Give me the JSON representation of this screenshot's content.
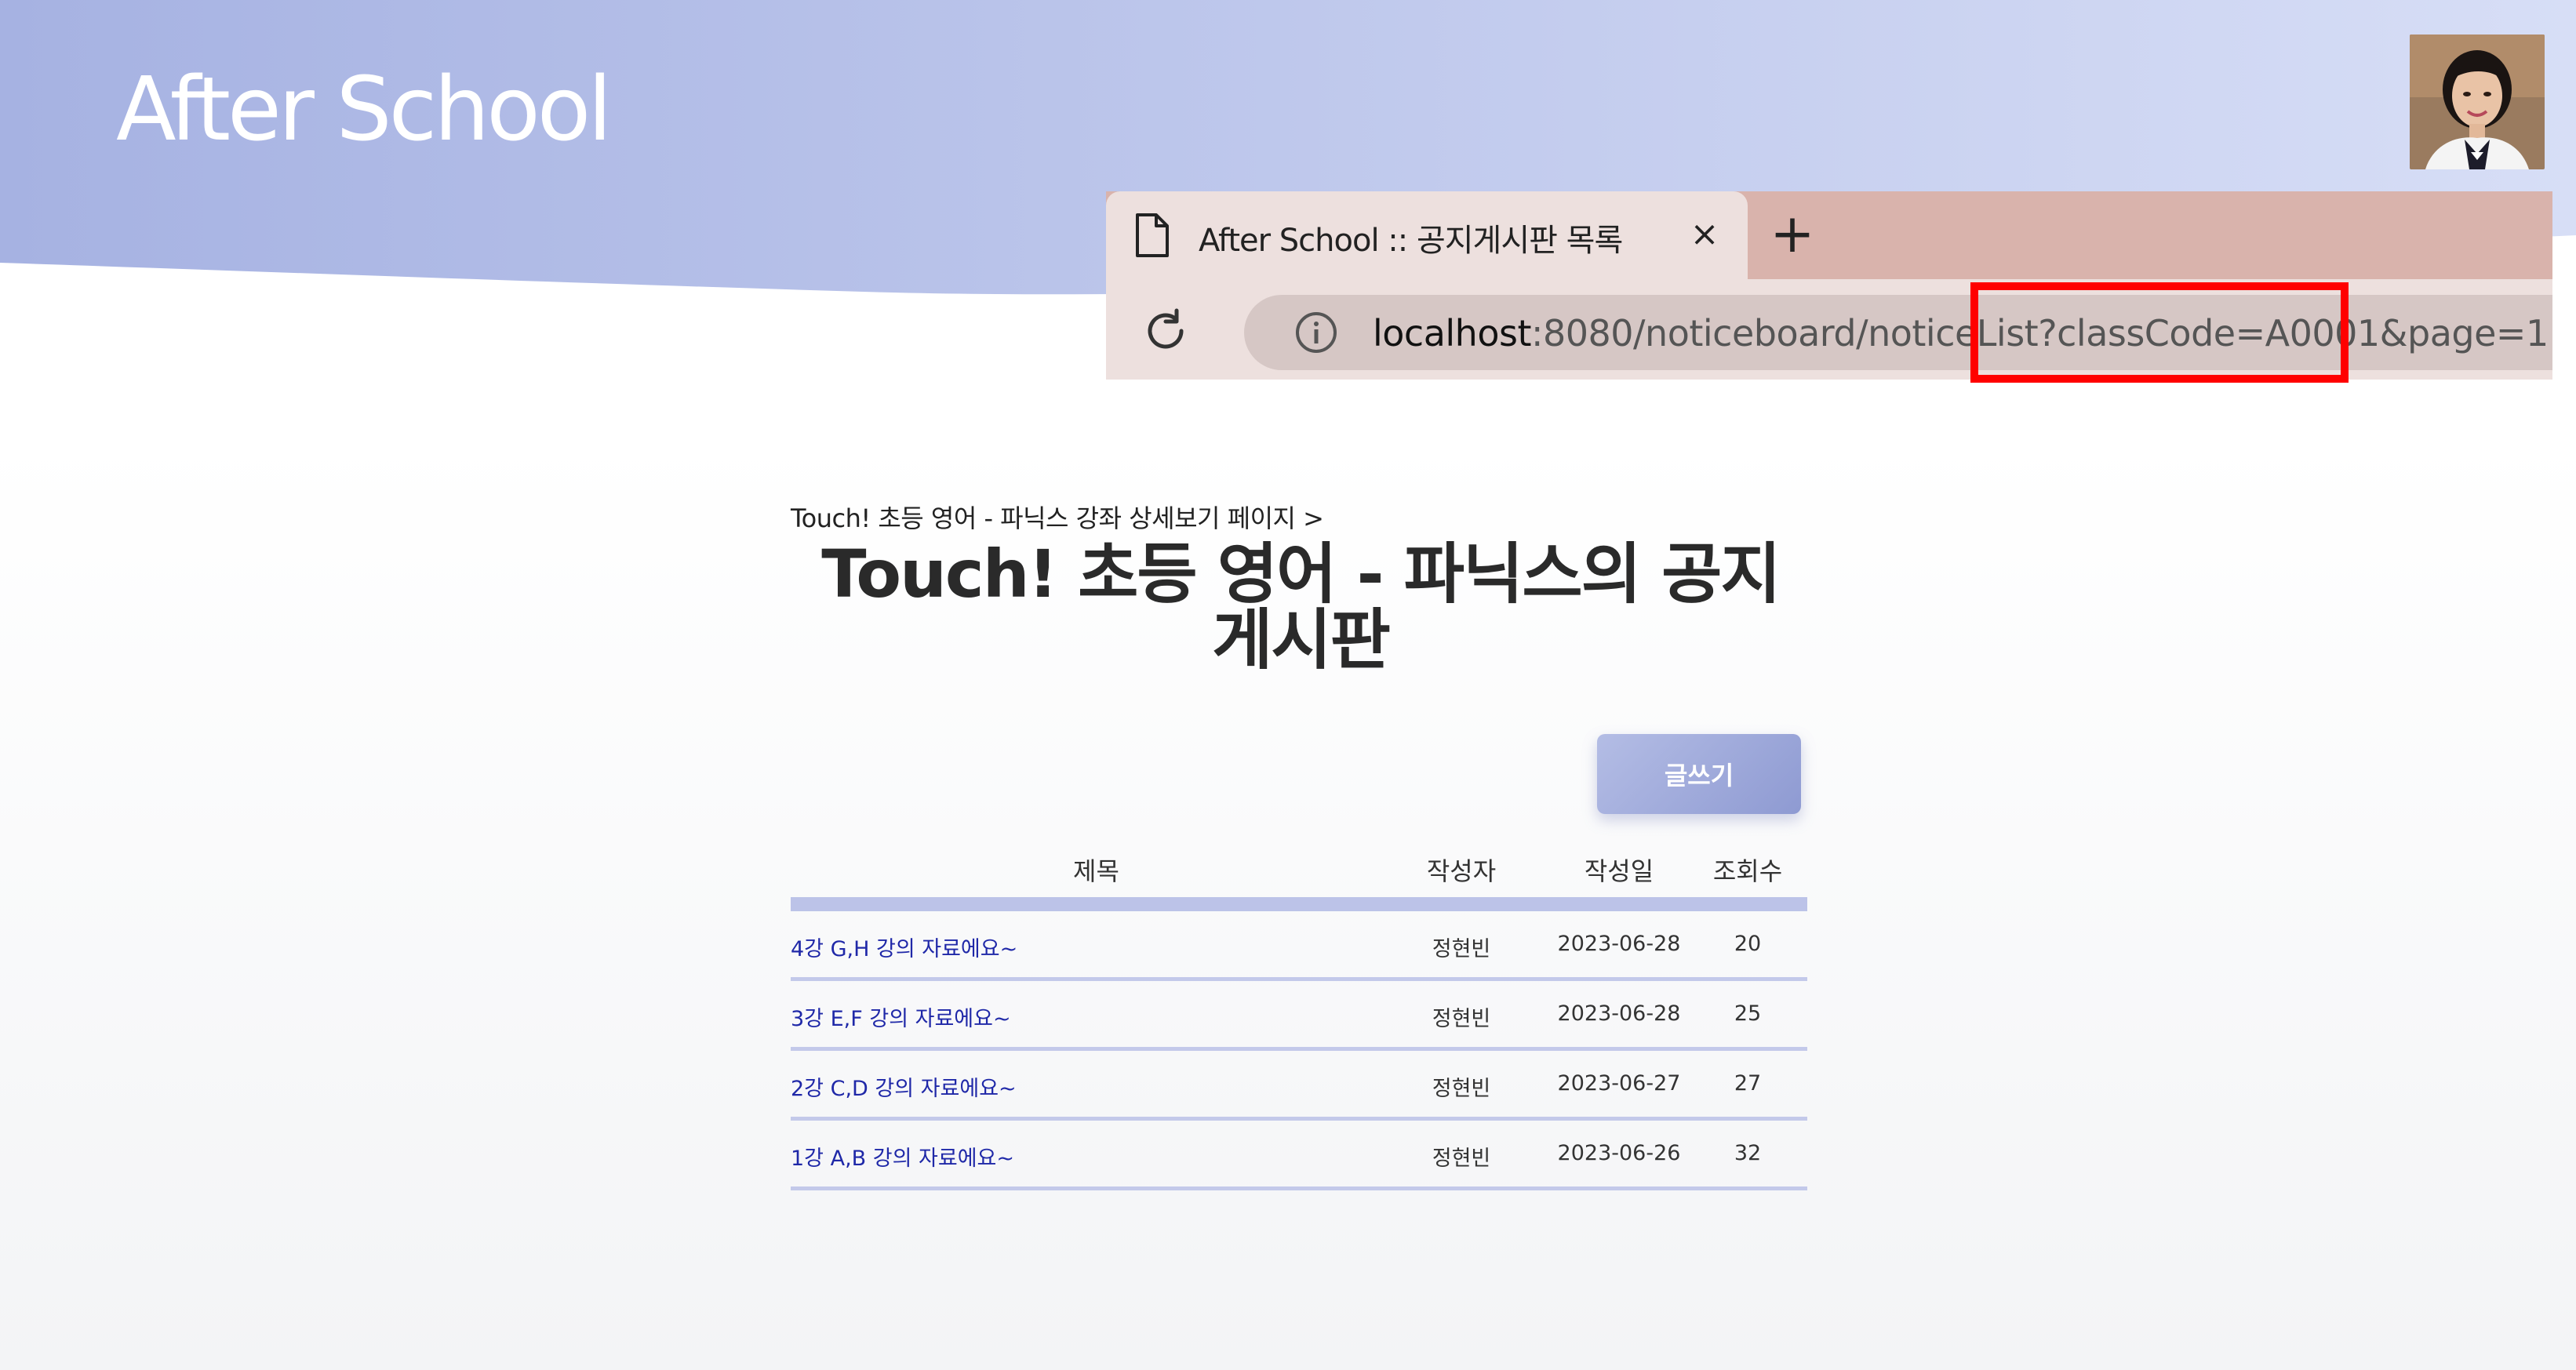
{
  "header": {
    "site_title": "After School",
    "colors": {
      "gradient_start": "#a6b2e2",
      "gradient_end": "#d7def6"
    }
  },
  "browser": {
    "tab_title": "After School :: 공지게시판 목록",
    "tab_close_label": "×",
    "new_tab_label": "+",
    "url_host": "localhost",
    "url_rest": ":8080/noticeboard/noticeList?classCode=A0001&page=1",
    "highlight_color": "#ff0000"
  },
  "content": {
    "breadcrumb": "Touch! 초등 영어 - 파닉스 강좌 상세보기 페이지 >",
    "title": "Touch! 초등 영어 - 파닉스의 공지 게시판",
    "write_button": "글쓰기",
    "columns": {
      "title": "제목",
      "writer": "작성자",
      "date": "작성일",
      "views": "조회수"
    },
    "rows": [
      {
        "title": "4강 G,H 강의 자료에요~",
        "writer": "정현빈",
        "date": "2023-06-28",
        "views": "20"
      },
      {
        "title": "3강 E,F 강의 자료에요~",
        "writer": "정현빈",
        "date": "2023-06-28",
        "views": "25"
      },
      {
        "title": "2강 C,D 강의 자료에요~",
        "writer": "정현빈",
        "date": "2023-06-27",
        "views": "27"
      },
      {
        "title": "1강 A,B 강의 자료에요~",
        "writer": "정현빈",
        "date": "2023-06-26",
        "views": "32"
      }
    ]
  },
  "icons": {
    "tab": "document-icon",
    "reload": "reload-icon",
    "site_info": "info-icon",
    "profile": "avatar-photo"
  }
}
